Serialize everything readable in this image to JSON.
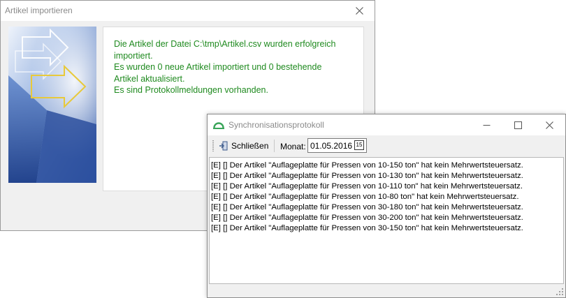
{
  "import_dialog": {
    "title": "Artikel importieren",
    "message": "Die Artikel der Datei C:\\tmp\\Artikel.csv wurden erfolgreich\nimportiert.\nEs wurden 0 neue Artikel importiert und 0 bestehende\nArtikel aktualisiert.\nEs sind Protokollmeldungen vorhanden.",
    "message_color": "#1f8a1f"
  },
  "sync_dialog": {
    "title": "Synchronisationsprotokoll",
    "toolbar": {
      "close_label": "Schließen",
      "month_label": "Monat:",
      "month_value": "01.05.2016",
      "calendar_glyph": "15"
    },
    "log_lines": [
      "[E] [] Der Artikel \"Auflageplatte für Pressen von 10-150 ton\" hat kein Mehrwertsteuersatz.",
      "[E] [] Der Artikel \"Auflageplatte für Pressen von 10-130 ton\" hat kein Mehrwertsteuersatz.",
      "[E] [] Der Artikel \"Auflageplatte für Pressen von 10-110 ton\" hat kein Mehrwertsteuersatz.",
      "[E] [] Der Artikel \"Auflageplatte für Pressen von 10-80 ton\" hat kein Mehrwertsteuersatz.",
      "[E] [] Der Artikel \"Auflageplatte für Pressen von 30-180 ton\" hat kein Mehrwertsteuersatz.",
      "[E] [] Der Artikel \"Auflageplatte für Pressen von 30-200 ton\" hat kein Mehrwertsteuersatz.",
      "[E] [] Der Artikel \"Auflageplatte für Pressen von 30-150 ton\" hat kein Mehrwertsteuersatz."
    ]
  },
  "icons": {
    "close": "close-icon",
    "minimize": "minimize-icon",
    "maximize": "maximize-icon",
    "exit": "exit-door-icon",
    "calendar": "calendar-icon",
    "app_logo": "app-logo-icon"
  },
  "colors": {
    "accent_green": "#1f8a1f",
    "logo_green": "#3aa55a",
    "graphic_blue": "#3a62ad"
  }
}
